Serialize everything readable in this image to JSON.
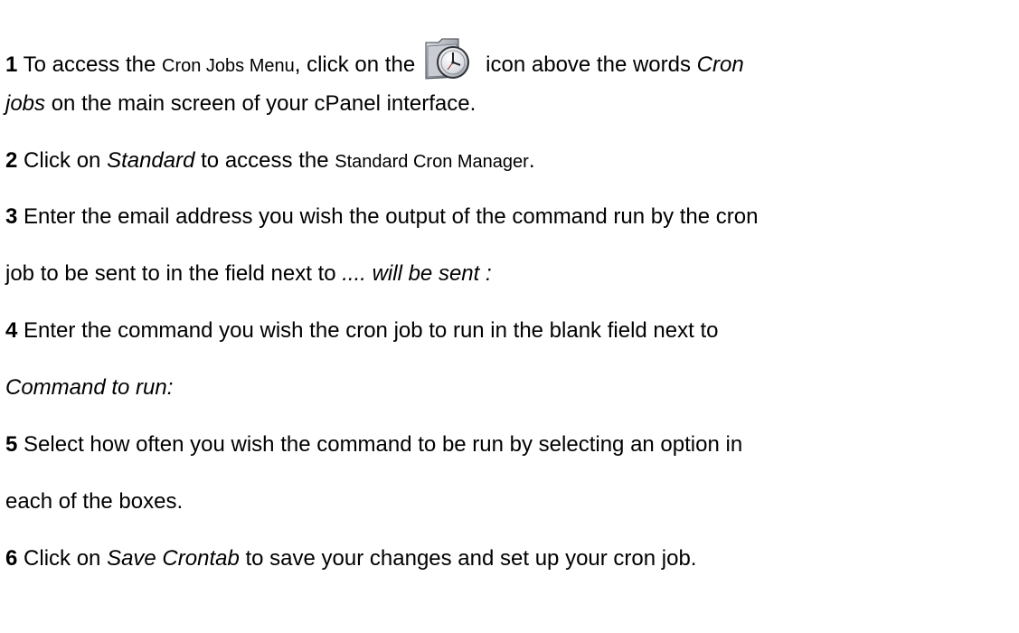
{
  "steps": [
    {
      "number": "1",
      "text_a": "To access the",
      "menu_name": "Cron Jobs Menu",
      "text_b": ", click on the",
      "icon": "cron-jobs-clock-folder-icon",
      "text_c": "icon above the words",
      "italic_a": "Cron",
      "italic_b": "jobs",
      "text_d": "on the main screen of your cPanel interface."
    },
    {
      "number": "2",
      "text_a": "Click on",
      "italic": "Standard",
      "text_b": "to access the",
      "menu_name": "Standard Cron Manager",
      "text_c": "."
    },
    {
      "number": "3",
      "text_a": "Enter the email address you wish the output of the command run by the cron",
      "text_b": "job to be sent to in the field next to",
      "italic": ".... will be sent :"
    },
    {
      "number": "4",
      "text_a": "Enter the command you wish the cron job to run in the blank field next to",
      "italic": "Command to run:"
    },
    {
      "number": "5",
      "text_a": "Select how often you wish the command to be run by selecting an option in",
      "text_b": "each of the boxes."
    },
    {
      "number": "6",
      "text_a": "Click on",
      "italic": "Save Crontab",
      "text_b": "to save your changes and set up your cron job."
    }
  ]
}
